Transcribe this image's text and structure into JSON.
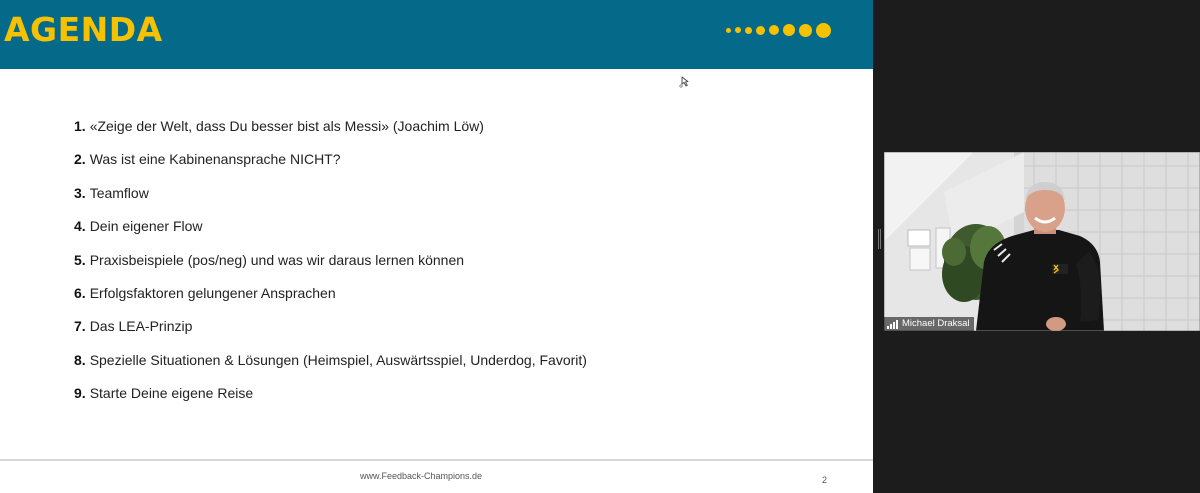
{
  "slide": {
    "title": "AGENDA",
    "items": [
      {
        "number": "1.",
        "text": "«Zeige der Welt, dass Du besser bist als Messi» (Joachim Löw)"
      },
      {
        "number": "2.",
        "text": "Was ist eine Kabinenansprache NICHT?"
      },
      {
        "number": "3.",
        "text": "Teamflow"
      },
      {
        "number": "4.",
        "text": "Dein eigener Flow"
      },
      {
        "number": "5.",
        "text": "Praxisbeispiele (pos/neg) und was wir daraus lernen können"
      },
      {
        "number": "6.",
        "text": "Erfolgsfaktoren gelungener Ansprachen"
      },
      {
        "number": "7.",
        "text": "Das LEA-Prinzip"
      },
      {
        "number": "8.",
        "text": "Spezielle Situationen & Lösungen (Heimspiel, Auswärtsspiel, Underdog, Favorit)"
      },
      {
        "number": "9.",
        "text": "Starte Deine eigene Reise"
      }
    ],
    "footer_url": "www.Feedback-Champions.de",
    "page_number": "2"
  },
  "participant": {
    "name": "Michael Draksal"
  },
  "colors": {
    "header_bg": "#056a8a",
    "accent_yellow": "#f6c200",
    "app_bg": "#1c1c1c"
  },
  "icons": {
    "cursor": "annotation-cursor-icon",
    "signal": "signal-strength-icon"
  }
}
